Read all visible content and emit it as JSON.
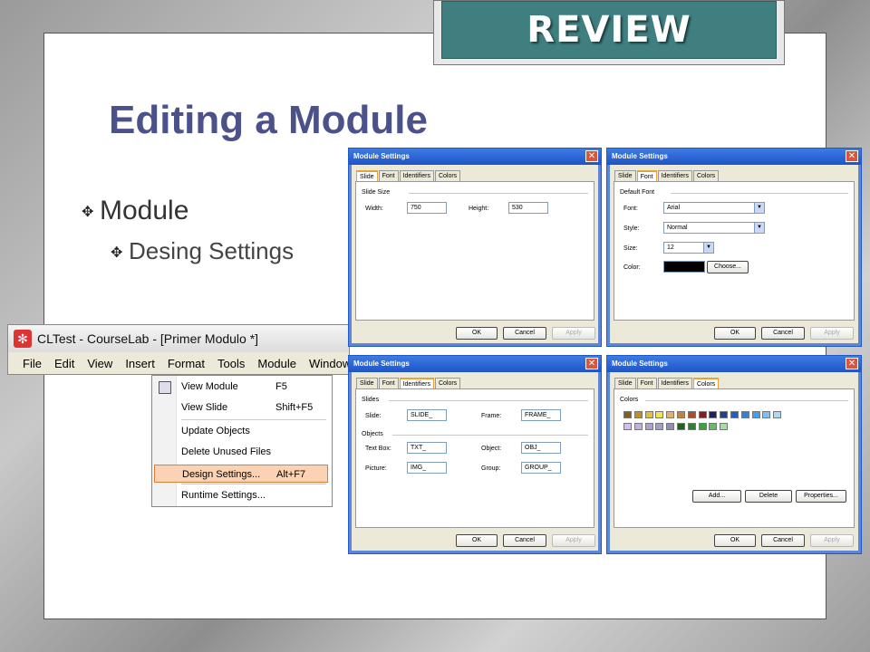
{
  "review_banner": "REVIEW",
  "title": "Editing a Module",
  "bullets": {
    "level1": "Module",
    "level2": "Desing Settings"
  },
  "courselab": {
    "window_title": "CLTest - CourseLab - [Primer Modulo *]",
    "menu": [
      "File",
      "Edit",
      "View",
      "Insert",
      "Format",
      "Tools",
      "Module",
      "Window"
    ],
    "context_menu": [
      {
        "label": "View Module",
        "shortcut": "F5"
      },
      {
        "label": "View Slide",
        "shortcut": "Shift+F5"
      },
      {
        "label": "Update Objects",
        "shortcut": ""
      },
      {
        "label": "Delete Unused Files",
        "shortcut": ""
      },
      {
        "label": "Design Settings...",
        "shortcut": "Alt+F7"
      },
      {
        "label": "Runtime Settings...",
        "shortcut": ""
      }
    ]
  },
  "dialog_common": {
    "title": "Module Settings",
    "tabs": [
      "Slide",
      "Font",
      "Identifiers",
      "Colors"
    ],
    "ok": "OK",
    "cancel": "Cancel",
    "apply": "Apply"
  },
  "dialog_slide": {
    "group": "Slide Size",
    "width_label": "Width:",
    "width_value": "750",
    "height_label": "Height:",
    "height_value": "530"
  },
  "dialog_font": {
    "group": "Default Font",
    "font_label": "Font:",
    "font_value": "Arial",
    "style_label": "Style:",
    "style_value": "Normal",
    "size_label": "Size:",
    "size_value": "12",
    "color_label": "Color:",
    "color_value": "#000000",
    "choose": "Choose..."
  },
  "dialog_identifiers": {
    "slides_group": "Slides",
    "slide_label": "Slide:",
    "slide_value": "SLIDE_",
    "frame_label": "Frame:",
    "frame_value": "FRAME_",
    "objects_group": "Objects",
    "textbox_label": "Text Box:",
    "textbox_value": "TXT_",
    "object_label": "Object:",
    "object_value": "OBJ_",
    "picture_label": "Picture:",
    "picture_value": "IMG_",
    "group_label": "Group:",
    "group_value": "GROUP_"
  },
  "dialog_colors": {
    "group": "Colors",
    "add": "Add...",
    "delete": "Delete",
    "properties": "Properties...",
    "swatches_row1": [
      "#806020",
      "#c09020",
      "#e0c040",
      "#f0e060",
      "#e0b070",
      "#c08040",
      "#a05030",
      "#802020",
      "#202060",
      "#204090",
      "#2060c0",
      "#3080e0",
      "#40a0f0",
      "#80c0f0",
      "#b0d8f0"
    ],
    "swatches_row2": [
      "#d0c0f0",
      "#c0b0e0",
      "#b0a0d0",
      "#a0a0c0",
      "#9090b0",
      "#206020",
      "#308030",
      "#40a040",
      "#60c060",
      "#a0e0a0"
    ]
  }
}
